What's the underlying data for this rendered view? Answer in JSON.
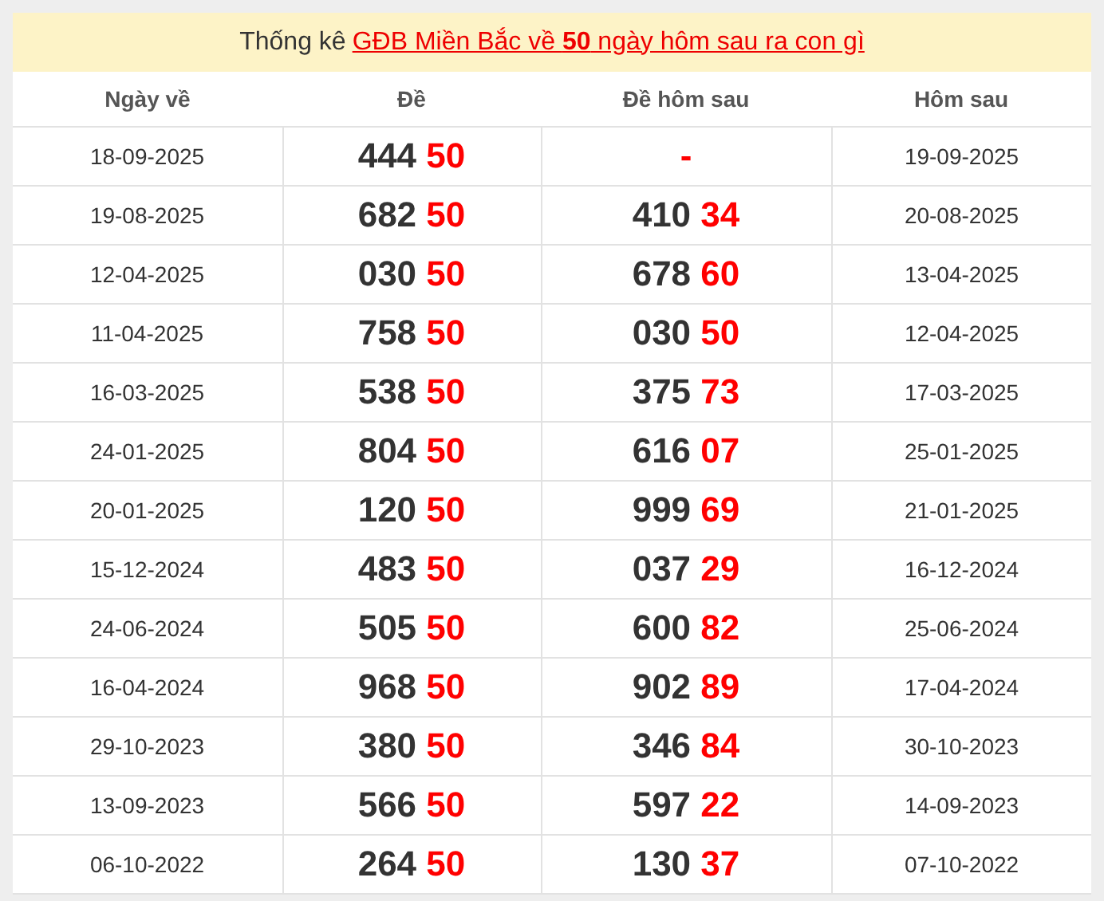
{
  "title": {
    "prefix": "Thống kê",
    "link": "GĐB Miền Bắc về **50** ngày hôm sau ra con gì"
  },
  "columns": [
    "Ngày về",
    "Đề",
    "Đề hôm sau",
    "Hôm sau"
  ],
  "rows": [
    {
      "date": "18-09-2025",
      "de_head": "444",
      "de_tail": "50",
      "next_missing": "-",
      "next_date": "19-09-2025"
    },
    {
      "date": "19-08-2025",
      "de_head": "682",
      "de_tail": "50",
      "next_head": "410",
      "next_tail": "34",
      "next_date": "20-08-2025"
    },
    {
      "date": "12-04-2025",
      "de_head": "030",
      "de_tail": "50",
      "next_head": "678",
      "next_tail": "60",
      "next_date": "13-04-2025"
    },
    {
      "date": "11-04-2025",
      "de_head": "758",
      "de_tail": "50",
      "next_head": "030",
      "next_tail": "50",
      "next_date": "12-04-2025"
    },
    {
      "date": "16-03-2025",
      "de_head": "538",
      "de_tail": "50",
      "next_head": "375",
      "next_tail": "73",
      "next_date": "17-03-2025"
    },
    {
      "date": "24-01-2025",
      "de_head": "804",
      "de_tail": "50",
      "next_head": "616",
      "next_tail": "07",
      "next_date": "25-01-2025"
    },
    {
      "date": "20-01-2025",
      "de_head": "120",
      "de_tail": "50",
      "next_head": "999",
      "next_tail": "69",
      "next_date": "21-01-2025"
    },
    {
      "date": "15-12-2024",
      "de_head": "483",
      "de_tail": "50",
      "next_head": "037",
      "next_tail": "29",
      "next_date": "16-12-2024"
    },
    {
      "date": "24-06-2024",
      "de_head": "505",
      "de_tail": "50",
      "next_head": "600",
      "next_tail": "82",
      "next_date": "25-06-2024"
    },
    {
      "date": "16-04-2024",
      "de_head": "968",
      "de_tail": "50",
      "next_head": "902",
      "next_tail": "89",
      "next_date": "17-04-2024"
    },
    {
      "date": "29-10-2023",
      "de_head": "380",
      "de_tail": "50",
      "next_head": "346",
      "next_tail": "84",
      "next_date": "30-10-2023"
    },
    {
      "date": "13-09-2023",
      "de_head": "566",
      "de_tail": "50",
      "next_head": "597",
      "next_tail": "22",
      "next_date": "14-09-2023"
    },
    {
      "date": "06-10-2022",
      "de_head": "264",
      "de_tail": "50",
      "next_head": "130",
      "next_tail": "37",
      "next_date": "07-10-2022"
    }
  ]
}
